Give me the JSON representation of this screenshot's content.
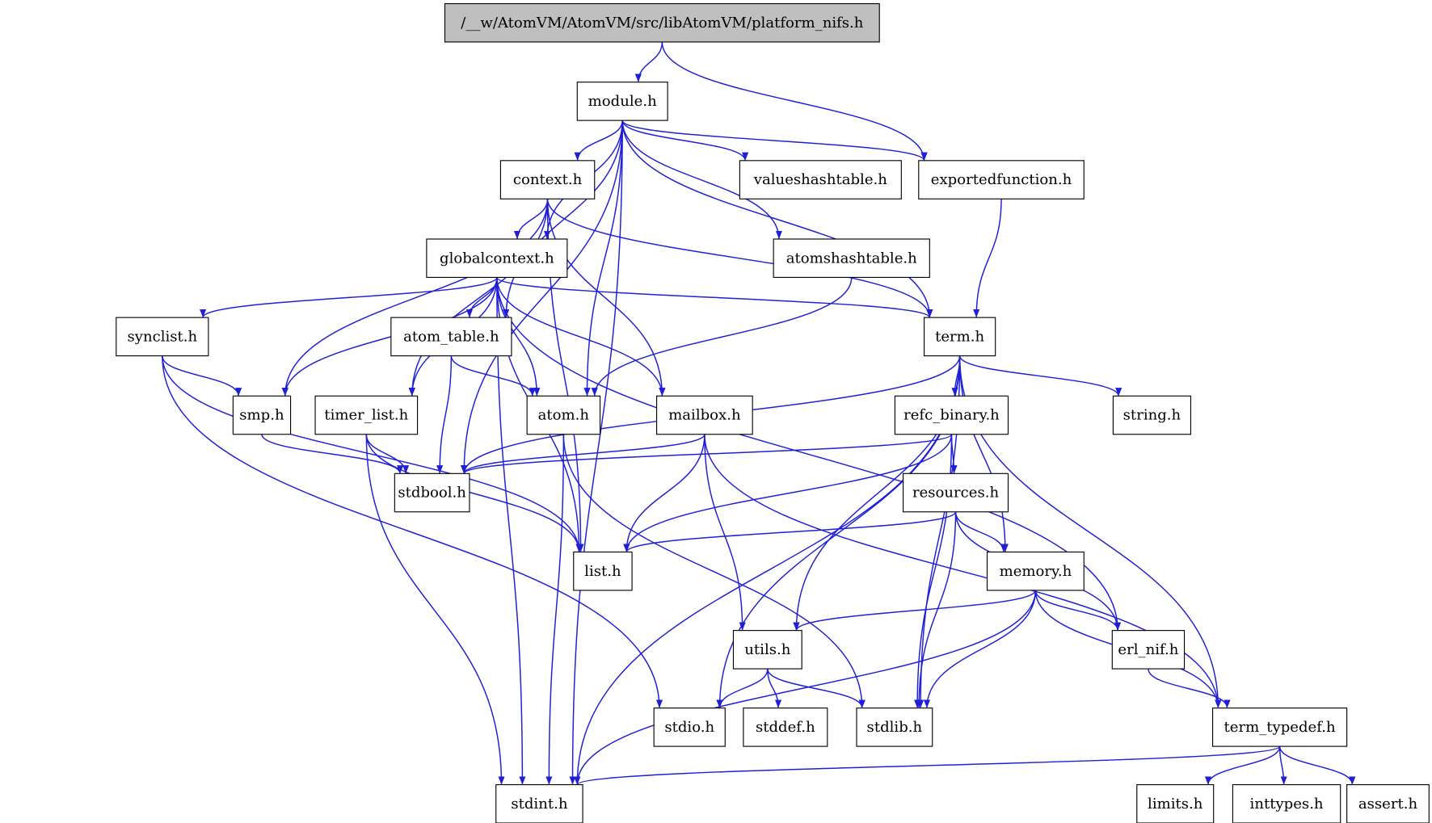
{
  "colors": {
    "edge": "#1f1fd6",
    "root_fill": "#bfbfbf",
    "node_fill": "#ffffff",
    "border": "#000000"
  },
  "root": "platform_nifs",
  "nodes": {
    "platform_nifs": "/__w/AtomVM/AtomVM/src/libAtomVM/platform_nifs.h",
    "module": "module.h",
    "context": "context.h",
    "valueshashtable": "valueshashtable.h",
    "exportedfunction": "exportedfunction.h",
    "globalcontext": "globalcontext.h",
    "atomshashtable": "atomshashtable.h",
    "synclist": "synclist.h",
    "atom_table": "atom_table.h",
    "term": "term.h",
    "smp": "smp.h",
    "timer_list": "timer_list.h",
    "atom": "atom.h",
    "mailbox": "mailbox.h",
    "refc_binary": "refc_binary.h",
    "string": "string.h",
    "stdbool": "stdbool.h",
    "resources": "resources.h",
    "list": "list.h",
    "memory": "memory.h",
    "utils": "utils.h",
    "erl_nif": "erl_nif.h",
    "stdio": "stdio.h",
    "stddef": "stddef.h",
    "stdlib": "stdlib.h",
    "term_typedef": "term_typedef.h",
    "limits": "limits.h",
    "inttypes": "inttypes.h",
    "assert": "assert.h",
    "stdint": "stdint.h"
  },
  "edges": [
    [
      "platform_nifs",
      "module"
    ],
    [
      "platform_nifs",
      "exportedfunction"
    ],
    [
      "module",
      "context"
    ],
    [
      "module",
      "valueshashtable"
    ],
    [
      "module",
      "exportedfunction"
    ],
    [
      "module",
      "globalcontext"
    ],
    [
      "module",
      "atomshashtable"
    ],
    [
      "module",
      "term"
    ],
    [
      "module",
      "atom_table"
    ],
    [
      "module",
      "atom"
    ],
    [
      "module",
      "stdbool"
    ],
    [
      "module",
      "stdint"
    ],
    [
      "context",
      "globalcontext"
    ],
    [
      "context",
      "term"
    ],
    [
      "context",
      "smp"
    ],
    [
      "context",
      "timer_list"
    ],
    [
      "context",
      "mailbox"
    ],
    [
      "context",
      "list"
    ],
    [
      "exportedfunction",
      "term"
    ],
    [
      "globalcontext",
      "synclist"
    ],
    [
      "globalcontext",
      "atom_table"
    ],
    [
      "globalcontext",
      "term"
    ],
    [
      "globalcontext",
      "smp"
    ],
    [
      "globalcontext",
      "timer_list"
    ],
    [
      "globalcontext",
      "atom"
    ],
    [
      "globalcontext",
      "mailbox"
    ],
    [
      "globalcontext",
      "list"
    ],
    [
      "globalcontext",
      "erl_nif"
    ],
    [
      "globalcontext",
      "stdint"
    ],
    [
      "atomshashtable",
      "atom"
    ],
    [
      "synclist",
      "smp"
    ],
    [
      "synclist",
      "list"
    ],
    [
      "synclist",
      "stdio"
    ],
    [
      "atom_table",
      "atom"
    ],
    [
      "atom_table",
      "stdbool"
    ],
    [
      "term",
      "refc_binary"
    ],
    [
      "term",
      "string"
    ],
    [
      "term",
      "memory"
    ],
    [
      "term",
      "utils"
    ],
    [
      "term",
      "stdbool"
    ],
    [
      "term",
      "stdio"
    ],
    [
      "term",
      "stdlib"
    ],
    [
      "term",
      "term_typedef"
    ],
    [
      "term",
      "stdint"
    ],
    [
      "smp",
      "stdbool"
    ],
    [
      "timer_list",
      "stdbool"
    ],
    [
      "timer_list",
      "list"
    ],
    [
      "timer_list",
      "stdint"
    ],
    [
      "atom",
      "stdint"
    ],
    [
      "atom",
      "stdlib"
    ],
    [
      "mailbox",
      "stdbool"
    ],
    [
      "mailbox",
      "list"
    ],
    [
      "mailbox",
      "utils"
    ],
    [
      "mailbox",
      "term_typedef"
    ],
    [
      "refc_binary",
      "resources"
    ],
    [
      "refc_binary",
      "stdbool"
    ],
    [
      "refc_binary",
      "list"
    ],
    [
      "refc_binary",
      "stdlib"
    ],
    [
      "resources",
      "memory"
    ],
    [
      "resources",
      "list"
    ],
    [
      "resources",
      "erl_nif"
    ],
    [
      "resources",
      "stdlib"
    ],
    [
      "memory",
      "utils"
    ],
    [
      "memory",
      "erl_nif"
    ],
    [
      "memory",
      "stdlib"
    ],
    [
      "memory",
      "term_typedef"
    ],
    [
      "memory",
      "stdint"
    ],
    [
      "utils",
      "stdio"
    ],
    [
      "utils",
      "stddef"
    ],
    [
      "utils",
      "stdlib"
    ],
    [
      "erl_nif",
      "term_typedef"
    ],
    [
      "term_typedef",
      "limits"
    ],
    [
      "term_typedef",
      "inttypes"
    ],
    [
      "term_typedef",
      "assert"
    ],
    [
      "term_typedef",
      "stdint"
    ]
  ]
}
